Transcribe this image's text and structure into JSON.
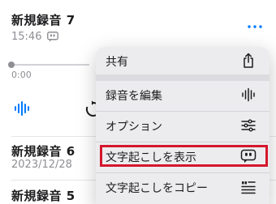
{
  "recordings": [
    {
      "title": "新規録音 7",
      "time": "15:46"
    },
    {
      "title": "新規録音 6",
      "date": "2023/12/28"
    },
    {
      "title": "新規録音 5"
    }
  ],
  "player": {
    "elapsed": "0:00"
  },
  "menu": {
    "items": [
      {
        "label": "共有",
        "icon": "share-icon"
      },
      {
        "label": "録音を編集",
        "icon": "waveform-icon"
      },
      {
        "label": "オプション",
        "icon": "sliders-icon"
      },
      {
        "label": "文字起こしを表示",
        "icon": "transcript-quote-icon"
      },
      {
        "label": "文字起こしをコピー",
        "icon": "copy-transcript-icon"
      }
    ]
  },
  "colors": {
    "highlight": "#d5172b",
    "accent": "#007aff"
  }
}
